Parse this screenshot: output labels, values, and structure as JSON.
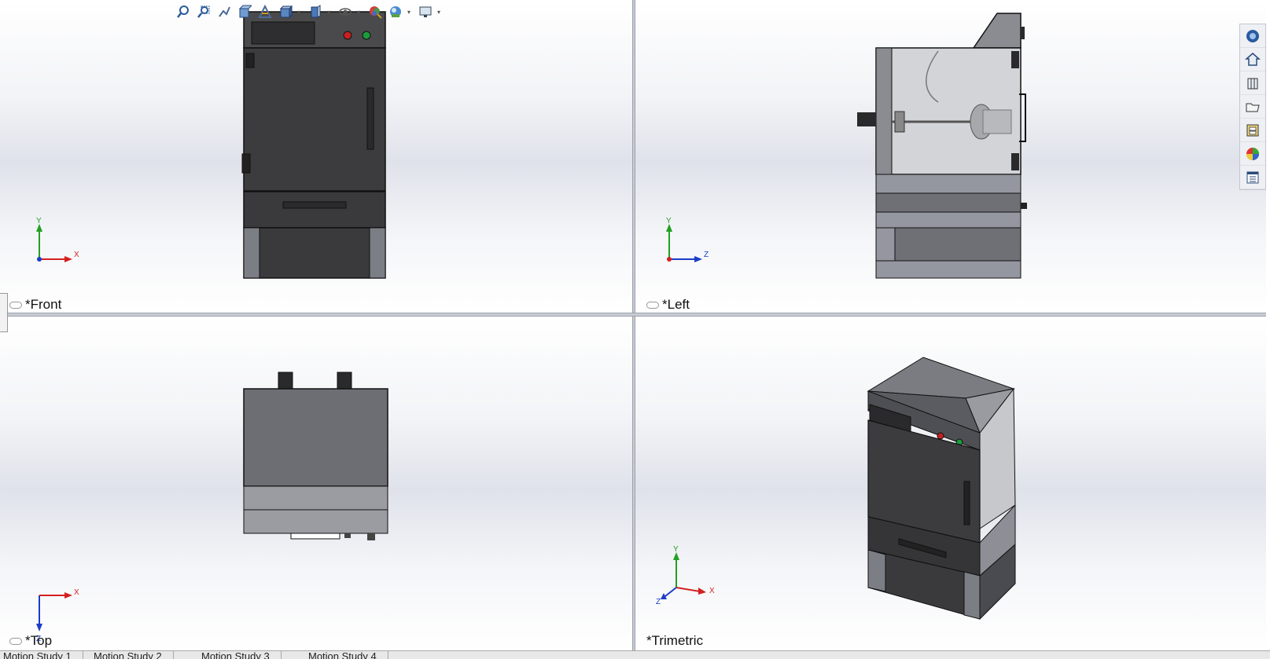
{
  "views": {
    "front": {
      "label": "*Front",
      "triad": {
        "v": "Y",
        "h": "X"
      }
    },
    "left": {
      "label": "*Left",
      "triad": {
        "v": "Y",
        "h": "Z"
      }
    },
    "top": {
      "label": "*Top",
      "triad": {
        "v": "Z",
        "h": "X"
      }
    },
    "trimetric": {
      "label": "*Trimetric",
      "triad": {
        "a": "Y",
        "b": "X",
        "c": "Z"
      }
    }
  },
  "toolbar": {
    "icons": [
      "zoom-to-fit-icon",
      "zoom-to-area-icon",
      "previous-view-icon",
      "section-view-icon",
      "dynamic-annotation-icon",
      "view-orientation-icon",
      "display-style-icon",
      "hide-show-items-icon",
      "edit-appearance-icon",
      "apply-scene-icon",
      "view-settings-icon"
    ]
  },
  "task_pane": {
    "icons": [
      "solidworks-resources-icon",
      "home-icon",
      "design-library-icon",
      "file-explorer-icon",
      "view-palette-icon",
      "appearances-scenes-icon",
      "custom-properties-icon"
    ]
  },
  "tabs": [
    "Motion Study 1",
    "Motion Study 2",
    "Motion Study 3",
    "Motion Study 4"
  ],
  "colors": {
    "x_axis": "#d42020",
    "y_axis": "#22a022",
    "z_axis": "#1a3cc8",
    "body_dark": "#3c3c3e",
    "body_grey": "#8a8c92"
  }
}
